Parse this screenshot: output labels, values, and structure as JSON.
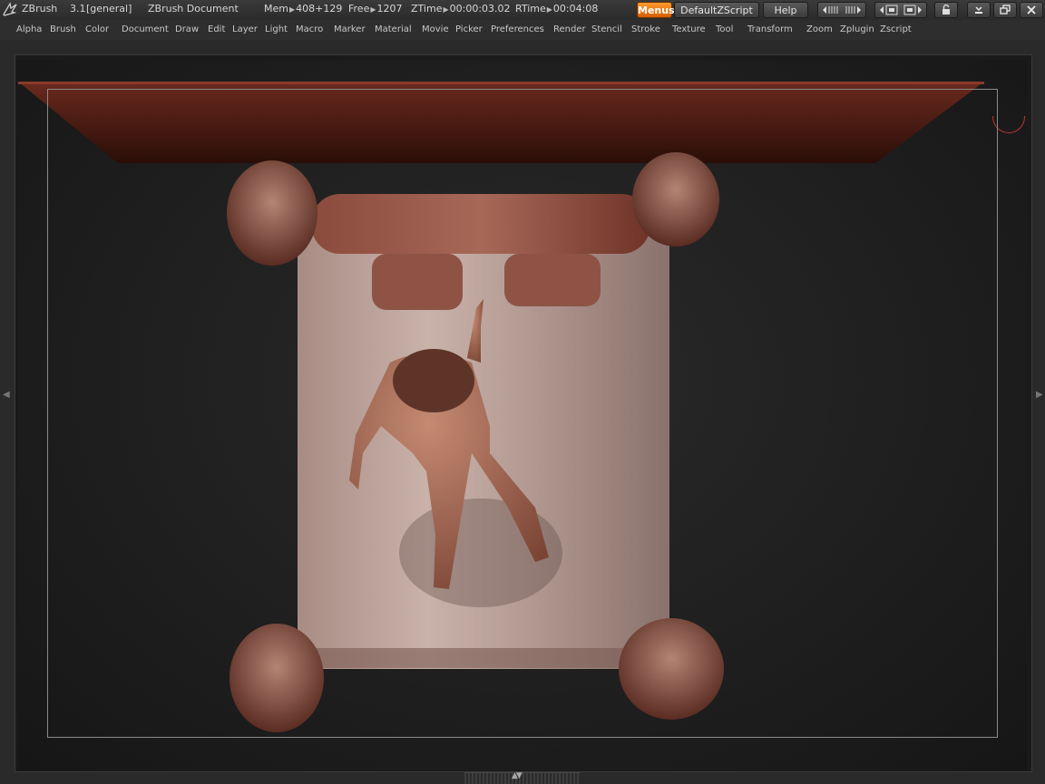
{
  "title": {
    "app": "ZBrush",
    "version": "3.1",
    "mode": "[general]",
    "document": "ZBrush Document",
    "mem_label": "Mem",
    "mem_value": "408+129",
    "free_label": "Free",
    "free_value": "1207",
    "ztime_label": "ZTime",
    "ztime_value": "00:00:03.02",
    "rtime_label": "RTime",
    "rtime_value": "00:04:08"
  },
  "buttons": {
    "menus": "Menus",
    "script": "DefaultZScript",
    "help": "Help"
  },
  "window": {
    "minimize_icon": "minimize-icon",
    "restore_icon": "restore-icon",
    "close_icon": "close-icon"
  },
  "menu": [
    "Alpha",
    "Brush",
    "Color",
    "Document",
    "Draw",
    "Edit",
    "Layer",
    "Light",
    "Macro",
    "Marker",
    "Material",
    "Movie",
    "Picker",
    "Preferences",
    "Render",
    "Stencil",
    "Stroke",
    "Texture",
    "Tool",
    "Transform",
    "Zoom",
    "Zplugin",
    "Zscript"
  ],
  "colors": {
    "accent": "#f07a10",
    "material": "#8a4a3c",
    "mattress": "#b89a90"
  }
}
